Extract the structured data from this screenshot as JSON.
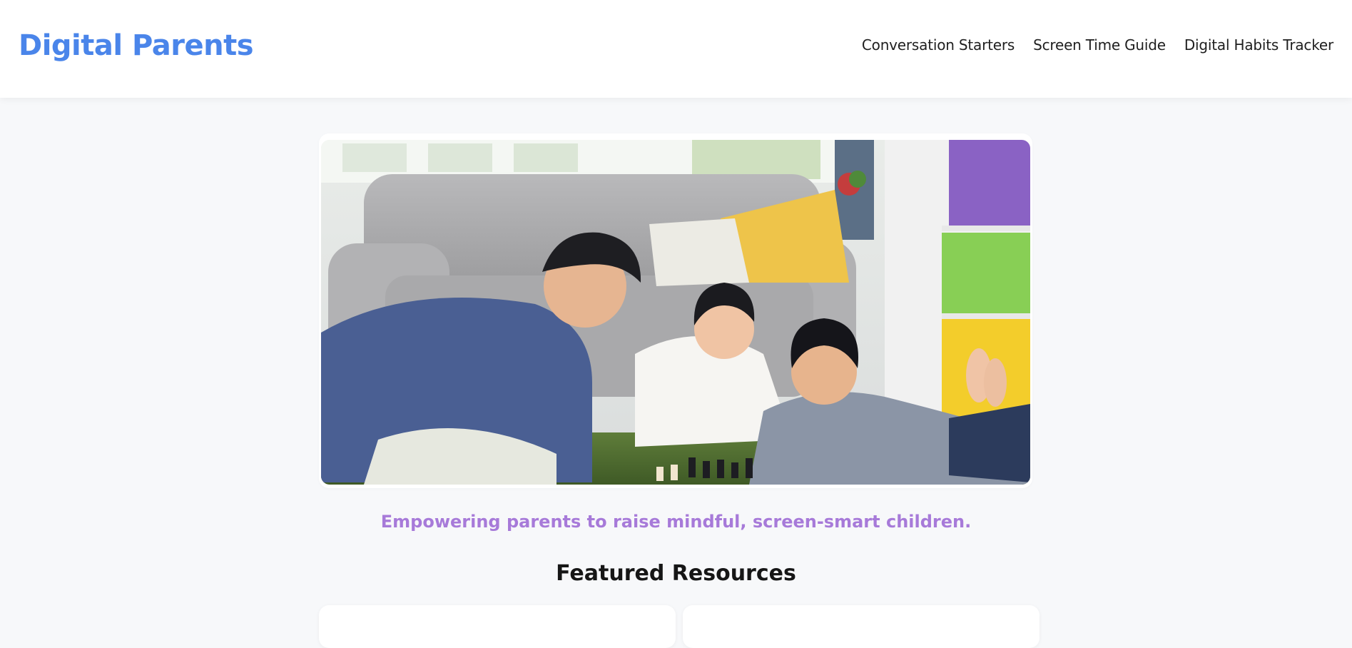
{
  "header": {
    "logo": "Digital Parents",
    "nav": [
      {
        "label": "Conversation Starters"
      },
      {
        "label": "Screen Time Guide"
      },
      {
        "label": "Digital Habits Tracker"
      }
    ]
  },
  "hero": {
    "image_alt": "A family playing chess on the living room floor",
    "tagline": "Empowering parents to raise mindful, screen-smart children."
  },
  "featured": {
    "title": "Featured Resources"
  },
  "colors": {
    "brand": "#4a85ea",
    "tagline": "#a77ad9",
    "background": "#f7f8fa"
  }
}
